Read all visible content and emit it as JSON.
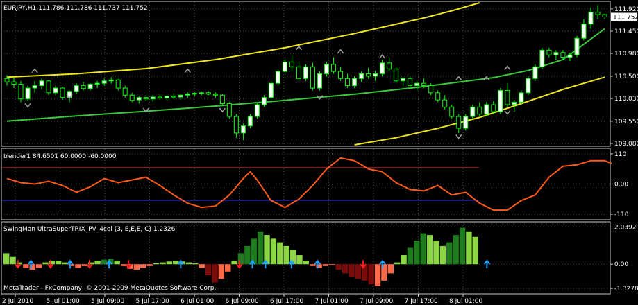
{
  "main": {
    "label": "EURJPY,H1  111.786 111.786 111.737 111.752",
    "price_ticks": [
      "111.920",
      "111.450",
      "110.980",
      "110.500",
      "110.030",
      "109.550",
      "109.080"
    ],
    "current_price": "111.752",
    "ylim": [
      109.05,
      112.05
    ],
    "candles": [
      [
        110.45,
        110.52,
        110.3,
        110.38
      ],
      [
        110.38,
        110.48,
        110.25,
        110.33
      ],
      [
        110.33,
        110.4,
        109.95,
        110.02
      ],
      [
        110.02,
        110.3,
        109.98,
        110.25
      ],
      [
        110.25,
        110.4,
        110.15,
        110.3
      ],
      [
        110.3,
        110.45,
        110.22,
        110.4
      ],
      [
        110.4,
        110.42,
        110.1,
        110.15
      ],
      [
        110.15,
        110.3,
        110.1,
        110.25
      ],
      [
        110.25,
        110.28,
        110.0,
        110.05
      ],
      [
        110.05,
        110.2,
        109.95,
        110.18
      ],
      [
        110.18,
        110.35,
        110.12,
        110.3
      ],
      [
        110.3,
        110.38,
        110.2,
        110.24
      ],
      [
        110.24,
        110.35,
        110.2,
        110.33
      ],
      [
        110.33,
        110.4,
        110.25,
        110.35
      ],
      [
        110.35,
        110.45,
        110.3,
        110.4
      ],
      [
        110.4,
        110.48,
        110.34,
        110.42
      ],
      [
        110.42,
        110.44,
        110.2,
        110.25
      ],
      [
        110.25,
        110.3,
        110.05,
        110.1
      ],
      [
        110.1,
        110.15,
        109.95,
        109.99
      ],
      [
        110.0,
        110.08,
        109.92,
        110.05
      ],
      [
        110.05,
        110.1,
        109.98,
        110.02
      ],
      [
        110.02,
        110.1,
        109.96,
        110.06
      ],
      [
        110.06,
        110.12,
        110.0,
        110.04
      ],
      [
        110.04,
        110.1,
        109.99,
        110.08
      ],
      [
        110.08,
        110.14,
        110.02,
        110.06
      ],
      [
        110.06,
        110.12,
        110.0,
        110.1
      ],
      [
        110.1,
        110.16,
        110.05,
        110.12
      ],
      [
        110.12,
        110.16,
        110.08,
        110.14
      ],
      [
        110.14,
        110.18,
        110.1,
        110.15
      ],
      [
        110.15,
        110.18,
        110.1,
        110.12
      ],
      [
        110.12,
        110.16,
        110.05,
        110.1
      ],
      [
        110.1,
        110.12,
        109.9,
        109.92
      ],
      [
        109.92,
        109.95,
        109.6,
        109.65
      ],
      [
        109.65,
        109.7,
        109.2,
        109.3
      ],
      [
        109.3,
        109.5,
        109.15,
        109.45
      ],
      [
        109.45,
        109.7,
        109.4,
        109.65
      ],
      [
        109.65,
        109.95,
        109.6,
        109.9
      ],
      [
        109.9,
        110.1,
        109.85,
        110.05
      ],
      [
        110.05,
        110.4,
        110.0,
        110.35
      ],
      [
        110.35,
        110.65,
        110.3,
        110.6
      ],
      [
        110.6,
        110.85,
        110.55,
        110.8
      ],
      [
        110.8,
        110.95,
        110.6,
        110.7
      ],
      [
        110.7,
        110.8,
        110.4,
        110.45
      ],
      [
        110.45,
        110.75,
        110.4,
        110.7
      ],
      [
        110.7,
        110.78,
        110.2,
        110.25
      ],
      [
        110.25,
        110.6,
        110.2,
        110.55
      ],
      [
        110.55,
        110.8,
        110.5,
        110.75
      ],
      [
        110.75,
        110.9,
        110.55,
        110.6
      ],
      [
        110.6,
        110.7,
        110.4,
        110.45
      ],
      [
        110.45,
        110.55,
        110.25,
        110.3
      ],
      [
        110.3,
        110.5,
        110.25,
        110.45
      ],
      [
        110.45,
        110.6,
        110.38,
        110.55
      ],
      [
        110.55,
        110.68,
        110.45,
        110.5
      ],
      [
        110.5,
        110.62,
        110.4,
        110.55
      ],
      [
        110.55,
        110.85,
        110.5,
        110.78
      ],
      [
        110.78,
        110.9,
        110.6,
        110.65
      ],
      [
        110.65,
        110.7,
        110.35,
        110.4
      ],
      [
        110.4,
        110.48,
        110.3,
        110.45
      ],
      [
        110.45,
        110.5,
        110.25,
        110.3
      ],
      [
        110.3,
        110.4,
        110.2,
        110.35
      ],
      [
        110.35,
        110.45,
        110.25,
        110.3
      ],
      [
        110.3,
        110.35,
        110.1,
        110.15
      ],
      [
        110.15,
        110.2,
        109.95,
        110.0
      ],
      [
        110.0,
        110.1,
        109.8,
        109.85
      ],
      [
        109.85,
        109.9,
        109.6,
        109.65
      ],
      [
        109.65,
        109.7,
        109.3,
        109.4
      ],
      [
        109.4,
        109.7,
        109.35,
        109.65
      ],
      [
        109.65,
        109.9,
        109.6,
        109.85
      ],
      [
        109.85,
        109.95,
        109.65,
        109.7
      ],
      [
        109.7,
        109.95,
        109.65,
        109.9
      ],
      [
        109.9,
        109.98,
        109.7,
        109.75
      ],
      [
        109.75,
        110.25,
        109.7,
        110.2
      ],
      [
        110.2,
        110.35,
        109.85,
        109.9
      ],
      [
        109.9,
        110.0,
        109.75,
        109.95
      ],
      [
        109.95,
        110.2,
        109.9,
        110.15
      ],
      [
        110.15,
        110.5,
        110.1,
        110.45
      ],
      [
        110.45,
        110.75,
        110.4,
        110.7
      ],
      [
        110.7,
        111.1,
        110.65,
        111.05
      ],
      [
        111.05,
        111.1,
        110.9,
        110.95
      ],
      [
        110.95,
        111.05,
        110.85,
        111.0
      ],
      [
        111.0,
        111.05,
        110.85,
        110.9
      ],
      [
        110.9,
        111.0,
        110.82,
        110.95
      ],
      [
        110.95,
        111.35,
        110.9,
        111.3
      ],
      [
        111.3,
        111.7,
        111.25,
        111.6
      ],
      [
        111.6,
        111.95,
        111.5,
        111.85
      ],
      [
        111.85,
        112.0,
        111.7,
        111.8
      ],
      [
        111.8,
        111.82,
        111.7,
        111.75
      ]
    ],
    "ma_green": [
      [
        0,
        109.55
      ],
      [
        10,
        109.66
      ],
      [
        20,
        109.76
      ],
      [
        30,
        109.87
      ],
      [
        40,
        109.99
      ],
      [
        50,
        110.12
      ],
      [
        60,
        110.28
      ],
      [
        70,
        110.47
      ],
      [
        75,
        110.62
      ],
      [
        80,
        110.85
      ],
      [
        86,
        111.5
      ]
    ],
    "band_upper": [
      [
        0,
        110.48
      ],
      [
        10,
        110.55
      ],
      [
        20,
        110.66
      ],
      [
        30,
        110.85
      ],
      [
        40,
        111.1
      ],
      [
        50,
        111.4
      ],
      [
        60,
        111.73
      ],
      [
        64,
        111.88
      ],
      [
        68,
        112.05
      ]
    ],
    "band_lower": [
      [
        50,
        109.05
      ],
      [
        56,
        109.2
      ],
      [
        62,
        109.4
      ],
      [
        68,
        109.63
      ],
      [
        74,
        109.92
      ],
      [
        80,
        110.22
      ],
      [
        86,
        110.48
      ]
    ],
    "fractals_up": [
      [
        4,
        110.62
      ],
      [
        26,
        110.62
      ],
      [
        42,
        111.1
      ],
      [
        48,
        111.03
      ],
      [
        54,
        110.92
      ],
      [
        65,
        110.46
      ],
      [
        69,
        110.46
      ],
      [
        72,
        110.68
      ]
    ],
    "fractals_down": [
      [
        3,
        109.88
      ],
      [
        9,
        110.07
      ],
      [
        20,
        109.78
      ],
      [
        31,
        109.78
      ],
      [
        45,
        110.05
      ],
      [
        65,
        109.22
      ],
      [
        72,
        109.73
      ]
    ]
  },
  "trender": {
    "label": "trender1 84.6501 60.0000 -60.0000",
    "ticks": [
      "110",
      "0.00",
      "-110"
    ],
    "levels": {
      "upper": 60,
      "lower": -60
    },
    "level_colors": {
      "upper": "#b22222",
      "lower": "#1a1adc"
    },
    "line_color": "#ff5a1a",
    "ylim": [
      -125,
      125
    ],
    "values": [
      [
        0,
        20
      ],
      [
        2,
        5
      ],
      [
        4,
        0
      ],
      [
        6,
        10
      ],
      [
        8,
        -5
      ],
      [
        10,
        -30
      ],
      [
        12,
        -10
      ],
      [
        14,
        20
      ],
      [
        16,
        5
      ],
      [
        18,
        15
      ],
      [
        20,
        25
      ],
      [
        22,
        -5
      ],
      [
        24,
        -40
      ],
      [
        26,
        -70
      ],
      [
        28,
        -85
      ],
      [
        30,
        -80
      ],
      [
        32,
        -40
      ],
      [
        34,
        20
      ],
      [
        35,
        45
      ],
      [
        36,
        15
      ],
      [
        38,
        -60
      ],
      [
        40,
        -85
      ],
      [
        42,
        -55
      ],
      [
        44,
        -5
      ],
      [
        46,
        55
      ],
      [
        48,
        95
      ],
      [
        50,
        85
      ],
      [
        52,
        55
      ],
      [
        54,
        45
      ],
      [
        56,
        5
      ],
      [
        58,
        -20
      ],
      [
        60,
        -25
      ],
      [
        62,
        -5
      ],
      [
        64,
        -40
      ],
      [
        66,
        -30
      ],
      [
        68,
        -70
      ],
      [
        70,
        -95
      ],
      [
        72,
        -95
      ],
      [
        74,
        -60
      ],
      [
        76,
        -40
      ],
      [
        78,
        25
      ],
      [
        80,
        65
      ],
      [
        82,
        70
      ],
      [
        84,
        85
      ],
      [
        86,
        85
      ],
      [
        87,
        75
      ]
    ]
  },
  "trix": {
    "label": "SwingMan UltraSuperTRIX_PV_4col (3, E,E,E, C) 1.2326",
    "ticks": [
      "2.0392",
      "0.00",
      "-1.3278"
    ],
    "ylim": [
      -1.55,
      2.25
    ],
    "colors": {
      "up_strong": "#1e7c1e",
      "up_weak": "#8cd646",
      "down_strong": "#7a0c0c",
      "down_weak": "#ff6a4a"
    },
    "bars": [
      [
        0.6,
        "up_weak"
      ],
      [
        0.4,
        "up_weak"
      ],
      [
        0.1,
        "up_weak"
      ],
      [
        -0.2,
        "down_weak"
      ],
      [
        -0.3,
        "down_weak"
      ],
      [
        -0.2,
        "down_weak"
      ],
      [
        0.1,
        "up_weak"
      ],
      [
        0.2,
        "up_weak"
      ],
      [
        0.2,
        "up_weak"
      ],
      [
        0.1,
        "up_weak"
      ],
      [
        -0.1,
        "down_weak"
      ],
      [
        -0.2,
        "down_weak"
      ],
      [
        -0.1,
        "down_weak"
      ],
      [
        0.1,
        "up_weak"
      ],
      [
        0.2,
        "up_weak"
      ],
      [
        0.25,
        "up_strong"
      ],
      [
        0.3,
        "up_strong"
      ],
      [
        0.2,
        "up_weak"
      ],
      [
        -0.1,
        "down_weak"
      ],
      [
        -0.25,
        "down_weak"
      ],
      [
        -0.3,
        "down_weak"
      ],
      [
        -0.2,
        "down_weak"
      ],
      [
        -0.1,
        "down_weak"
      ],
      [
        0.05,
        "up_weak"
      ],
      [
        0.1,
        "up_weak"
      ],
      [
        0.15,
        "up_weak"
      ],
      [
        0.2,
        "up_weak"
      ],
      [
        0.15,
        "up_weak"
      ],
      [
        0.1,
        "up_weak"
      ],
      [
        0.05,
        "up_weak"
      ],
      [
        -0.2,
        "down_weak"
      ],
      [
        -0.6,
        "down_strong"
      ],
      [
        -1.0,
        "down_strong"
      ],
      [
        -0.8,
        "down_weak"
      ],
      [
        -0.4,
        "down_weak"
      ],
      [
        0.2,
        "up_weak"
      ],
      [
        0.6,
        "up_strong"
      ],
      [
        1.0,
        "up_strong"
      ],
      [
        1.4,
        "up_strong"
      ],
      [
        1.8,
        "up_strong"
      ],
      [
        1.6,
        "up_weak"
      ],
      [
        1.4,
        "up_weak"
      ],
      [
        1.2,
        "up_weak"
      ],
      [
        1.0,
        "up_weak"
      ],
      [
        0.8,
        "up_weak"
      ],
      [
        0.5,
        "up_weak"
      ],
      [
        0.2,
        "up_weak"
      ],
      [
        -0.1,
        "down_weak"
      ],
      [
        -0.2,
        "down_weak"
      ],
      [
        -0.1,
        "down_weak"
      ],
      [
        -0.05,
        "down_weak"
      ],
      [
        -0.3,
        "down_strong"
      ],
      [
        -0.5,
        "down_strong"
      ],
      [
        -0.7,
        "down_strong"
      ],
      [
        -0.8,
        "down_strong"
      ],
      [
        -0.9,
        "down_strong"
      ],
      [
        -1.1,
        "down_strong"
      ],
      [
        -1.2,
        "down_weak"
      ],
      [
        -0.9,
        "down_weak"
      ],
      [
        -0.5,
        "down_weak"
      ],
      [
        0.1,
        "up_weak"
      ],
      [
        0.5,
        "up_weak"
      ],
      [
        0.9,
        "up_strong"
      ],
      [
        1.3,
        "up_strong"
      ],
      [
        1.7,
        "up_strong"
      ],
      [
        1.6,
        "up_weak"
      ],
      [
        1.3,
        "up_weak"
      ],
      [
        1.0,
        "up_weak"
      ],
      [
        1.2,
        "up_strong"
      ],
      [
        1.6,
        "up_strong"
      ],
      [
        2.0,
        "up_strong"
      ],
      [
        1.8,
        "up_weak"
      ],
      [
        1.5,
        "up_weak"
      ]
    ],
    "arrows_down": [
      2,
      7,
      13,
      19,
      36,
      55
    ],
    "arrows_up": [
      4,
      10,
      16,
      27,
      38,
      40,
      44,
      48,
      58,
      74
    ],
    "watermark": "MetaTrader - FxCompany, © 2001-2009 MetaQuotes Software Corp."
  },
  "time_axis": {
    "labels": [
      "2 Jul 2010",
      "5 Jul 01:00",
      "5 Jul 09:00",
      "5 Jul 17:00",
      "6 Jul 01:00",
      "6 Jul 09:00",
      "6 Jul 17:00",
      "7 Jul 01:00",
      "7 Jul 09:00",
      "7 Jul 17:00",
      "8 Jul 01:00"
    ]
  },
  "colors": {
    "background": "#000000",
    "grid": "#4a5a4a",
    "frame": "#c8c8c8",
    "bull": "#ffffff",
    "bear": "#000000",
    "candle_outline": "#00ff00",
    "ma": "#3cc83c",
    "band": "#f0e61e",
    "fractal": "#a0a0a0",
    "arrow_up": "#1ea0ff",
    "arrow_down": "#ff1e1e"
  }
}
